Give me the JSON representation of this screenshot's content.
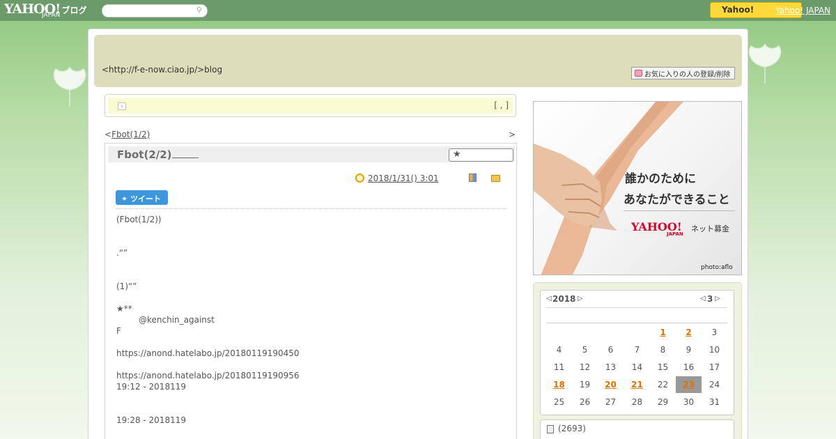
{
  "topbar": {
    "logo_yahoo": "YAHOO!",
    "logo_japan": "JAPAN",
    "logo_blog": "ブログ",
    "search_placeholder": "",
    "yahoo_button": "Yahoo!",
    "yahoo_japan_link": "Yahoo! JAPAN"
  },
  "header": {
    "blog_url": "<http://f-e-now.ciao.jp/>blog",
    "favorite_button": "お気に入りの人の登録/削除"
  },
  "notice": {
    "text": "[ , ]"
  },
  "post_nav": {
    "prev_prefix": "<",
    "prev_label": "Fbot(1/2)",
    "next_suffix": ">"
  },
  "article": {
    "title": "Fbot(2/2)",
    "date": "2018/1/31()  3:01",
    "tweet_label": "ツイート",
    "body": {
      "l1": "(Fbot(1/2))",
      "l2": ".“”",
      "l3": "(1)“”",
      "l4": "★**",
      "l5": "@kenchin_against",
      "l6": "F",
      "l7": "https://anond.hatelabo.jp/20180119190450",
      "l8": "https://anond.hatelabo.jp/20180119190956",
      "l9": "19:12 - 2018119",
      "l10": "19:28 - 2018119"
    }
  },
  "ad": {
    "line1": "誰かのためにあなたができること",
    "line1a": "誰かのために",
    "line1b": "あなたができること",
    "yahoo": "YAHOO!",
    "japan": "JAPAN",
    "donate": "ネット募金",
    "photo_credit": "photo:aflo"
  },
  "calendar": {
    "year": "2018",
    "month": "3",
    "days": [
      {
        "d": "1",
        "link": true
      },
      {
        "d": "2",
        "link": true
      },
      {
        "d": "3"
      },
      {
        "d": "4"
      },
      {
        "d": "5"
      },
      {
        "d": "6"
      },
      {
        "d": "7"
      },
      {
        "d": "8"
      },
      {
        "d": "9"
      },
      {
        "d": "10"
      },
      {
        "d": "11"
      },
      {
        "d": "12"
      },
      {
        "d": "13"
      },
      {
        "d": "14"
      },
      {
        "d": "15"
      },
      {
        "d": "16"
      },
      {
        "d": "17"
      },
      {
        "d": "18",
        "link": true
      },
      {
        "d": "19"
      },
      {
        "d": "20",
        "link": true
      },
      {
        "d": "21",
        "link": true
      },
      {
        "d": "22"
      },
      {
        "d": "23",
        "link": true,
        "today": true
      },
      {
        "d": "24"
      },
      {
        "d": "25"
      },
      {
        "d": "26"
      },
      {
        "d": "27"
      },
      {
        "d": "28"
      },
      {
        "d": "29"
      },
      {
        "d": "30"
      },
      {
        "d": "31"
      }
    ]
  },
  "post_count": "(2693)",
  "colors": {
    "topbar": "#6b9a6b",
    "header_band": "#ddddbb",
    "notice": "#fbfbd2",
    "calendar_link": "#e07000",
    "tweet_button": "#3d96dc",
    "yahoo_button": "#ffd83a"
  }
}
